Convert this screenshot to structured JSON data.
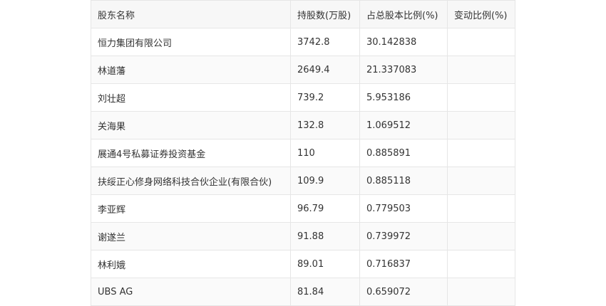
{
  "table": {
    "headers": [
      "股东名称",
      "持股数(万股)",
      "占总股本比例(%)",
      "变动比例(%)"
    ],
    "rows": [
      [
        "恒力集团有限公司",
        "3742.8",
        "30.142838",
        ""
      ],
      [
        "林道藩",
        "2649.4",
        "21.337083",
        ""
      ],
      [
        "刘壮超",
        "739.2",
        "5.953186",
        ""
      ],
      [
        "关海果",
        "132.8",
        "1.069512",
        ""
      ],
      [
        "展通4号私募证券投资基金",
        "110",
        "0.885891",
        ""
      ],
      [
        "扶绥正心修身网络科技合伙企业(有限合伙)",
        "109.9",
        "0.885118",
        ""
      ],
      [
        "李亚辉",
        "96.79",
        "0.779503",
        ""
      ],
      [
        "谢遂兰",
        "91.88",
        "0.739972",
        ""
      ],
      [
        "林利娥",
        "89.01",
        "0.716837",
        ""
      ],
      [
        "UBS AG",
        "81.84",
        "0.659072",
        ""
      ]
    ]
  }
}
